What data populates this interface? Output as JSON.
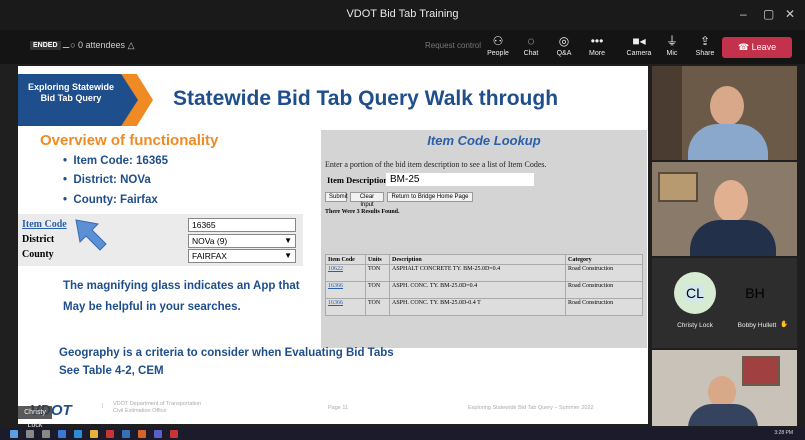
{
  "window": {
    "title": "VDOT Bid Tab Training",
    "min": "–",
    "max": "▢",
    "close": "✕"
  },
  "toolbar": {
    "ended": "ENDED",
    "attendees": "0 attendees",
    "request_control": "Request control",
    "buttons": [
      {
        "label": "People",
        "icon": "people-icon"
      },
      {
        "label": "Chat",
        "icon": "chat-icon"
      },
      {
        "label": "Q&A",
        "icon": "qa-icon"
      },
      {
        "label": "More",
        "icon": "more-icon"
      },
      {
        "label": "Camera",
        "icon": "camera-icon"
      },
      {
        "label": "Mic",
        "icon": "mic-icon"
      },
      {
        "label": "Share",
        "icon": "share-icon"
      }
    ],
    "leave": "Leave"
  },
  "slide": {
    "banner_box": "Exploring Statewide Bid Tab Query",
    "title": "Statewide Bid Tab Query Walk through",
    "overview": "Overview of functionality",
    "bullets": [
      "Item Code: 16365",
      "District: NOVa",
      "County: Fairfax"
    ],
    "form": [
      {
        "label": "Item Code",
        "value": "16365"
      },
      {
        "label": "District",
        "value": "NOVa (9)"
      },
      {
        "label": "County",
        "value": "FAIRFAX"
      }
    ],
    "magnify_line1": "The magnifying glass indicates an App that",
    "magnify_line2": "May be helpful in your searches.",
    "geo_line1": "Geography is a criteria to consider when Evaluating Bid Tabs",
    "geo_line2": "See Table 4-2, CEM",
    "lookup": {
      "title": "Item Code Lookup",
      "instruction": "Enter a portion of the bid item description to see a list of Item Codes.",
      "desc_label": "Item Description",
      "desc_value": "BM-25",
      "btn_submit": "Submit",
      "btn_clear": "Clear Input",
      "btn_return": "Return to Bridge Home Page",
      "found": "There Were 3 Results Found.",
      "headers": [
        "Item Code",
        "Units",
        "Description",
        "Category"
      ],
      "rows": [
        [
          "10622",
          "TON",
          "ASPHALT CONCRETE TY. BM-25.0D=0.4",
          "Road Construction"
        ],
        [
          "16366",
          "TON",
          "ASPH. CONC. TY. BM-25.0D=0.4",
          "Road Construction"
        ],
        [
          "16366",
          "TON",
          "ASPH. CONC. TY. BM-25.0D-0.4 T",
          "Road Construction"
        ]
      ]
    },
    "footer_logo": "VDOT",
    "footer_org1": "VDOT Department of Transportation",
    "footer_org2": "Civil Estimation Office",
    "footer_page": "Page 11",
    "footer_right": "Exploring Statewide Bid Tab Query – Summer 2022"
  },
  "presenter_label": "Christy Lock",
  "participants": [
    {
      "initials": "CL",
      "name": "Christy Lock",
      "color": "#d7ead2"
    },
    {
      "initials": "BH",
      "name": "Bobby Hullett",
      "color": "#d2e6f0"
    }
  ],
  "taskbar": {
    "time": "3:28 PM"
  }
}
